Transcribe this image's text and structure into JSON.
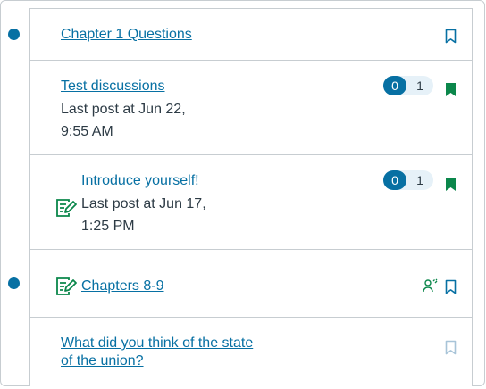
{
  "discussions": [
    {
      "title": "Chapter 1 Questions",
      "unread_indicator": true,
      "bookmark": "outline"
    },
    {
      "title": "Test discussions",
      "last_post_line1": "Last post at Jun 22,",
      "last_post_line2": "9:55 AM",
      "unread_count": "0",
      "total_count": "1",
      "bookmark": "filled"
    },
    {
      "title": "Introduce yourself!",
      "last_post_line1": "Last post at Jun 17,",
      "last_post_line2": "1:25 PM",
      "unread_count": "0",
      "total_count": "1",
      "bookmark": "filled",
      "icon": "assignment-edit-icon"
    },
    {
      "title": "Chapters 8-9",
      "unread_indicator": true,
      "bookmark": "outline",
      "icon": "assignment-edit-icon",
      "extra_icon": "group-users-icon"
    },
    {
      "title_line1": "What did you think of the state",
      "title_line2": "of the union?",
      "bookmark": "outline-muted"
    }
  ],
  "colors": {
    "link": "#0770a3",
    "unread_dot": "#0770a3",
    "bookmark_filled": "#0b874b",
    "assignment_icon": "#0b874b",
    "border": "#c7cdd1"
  }
}
